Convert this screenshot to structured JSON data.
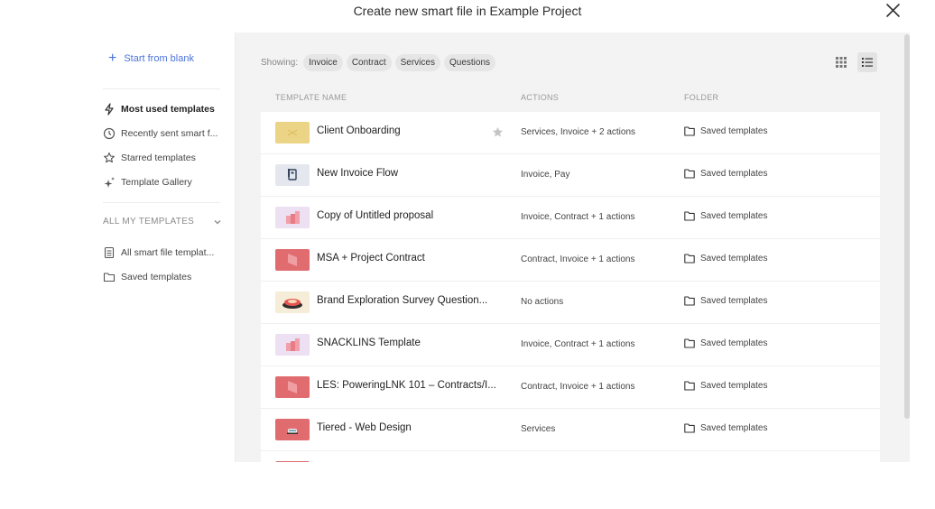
{
  "title": "Create new smart file in Example Project",
  "sidebar": {
    "start_blank": "Start from blank",
    "items": [
      {
        "label": "Most used templates",
        "icon": "lightning-icon",
        "active": true
      },
      {
        "label": "Recently sent smart f...",
        "icon": "clock-icon",
        "active": false
      },
      {
        "label": "Starred templates",
        "icon": "star-outline-icon",
        "active": false
      },
      {
        "label": "Template Gallery",
        "icon": "sparkle-icon",
        "active": false
      }
    ],
    "section_title": "ALL MY TEMPLATES",
    "section_items": [
      {
        "label": "All smart file templat...",
        "icon": "file-list-icon"
      },
      {
        "label": "Saved templates",
        "icon": "folder-outline-icon"
      }
    ]
  },
  "filters": {
    "label": "Showing:",
    "chips": [
      "Invoice",
      "Contract",
      "Services",
      "Questions"
    ]
  },
  "table": {
    "headers": {
      "name": "TEMPLATE NAME",
      "actions": "ACTIONS",
      "folder": "FOLDER"
    },
    "rows": [
      {
        "name": "Client Onboarding",
        "actions": "Services, Invoice + 2 actions",
        "folder": "Saved templates",
        "thumb_color": "#ecd486",
        "starred": true
      },
      {
        "name": "New Invoice Flow",
        "actions": "Invoice, Pay",
        "folder": "Saved templates",
        "thumb_color": "#e4e8ee",
        "starred": false
      },
      {
        "name": "Copy of Untitled proposal",
        "actions": "Invoice, Contract + 1 actions",
        "folder": "Saved templates",
        "thumb_color": "#ece0f2",
        "starred": false
      },
      {
        "name": "MSA + Project Contract",
        "actions": "Contract, Invoice + 1 actions",
        "folder": "Saved templates",
        "thumb_color": "#e06c70",
        "starred": false
      },
      {
        "name": "Brand Exploration Survey Question...",
        "actions": "No actions",
        "folder": "Saved templates",
        "thumb_color": "#f6edd8",
        "starred": false
      },
      {
        "name": "SNACKLINS Template",
        "actions": "Invoice, Contract + 1 actions",
        "folder": "Saved templates",
        "thumb_color": "#ece0f2",
        "starred": false
      },
      {
        "name": "LES: PoweringLNK 101 – Contracts/I...",
        "actions": "Contract, Invoice + 1 actions",
        "folder": "Saved templates",
        "thumb_color": "#e06c70",
        "starred": false
      },
      {
        "name": "Tiered - Web Design",
        "actions": "Services",
        "folder": "Saved templates",
        "thumb_color": "#e06c70",
        "starred": false
      },
      {
        "name": "",
        "actions": "",
        "folder": "",
        "thumb_color": "#e06c70",
        "starred": false
      }
    ]
  },
  "colors": {
    "accent": "#4a72d9",
    "panel_bg": "#f3f3f3",
    "chip_bg": "#e6e6e6"
  }
}
